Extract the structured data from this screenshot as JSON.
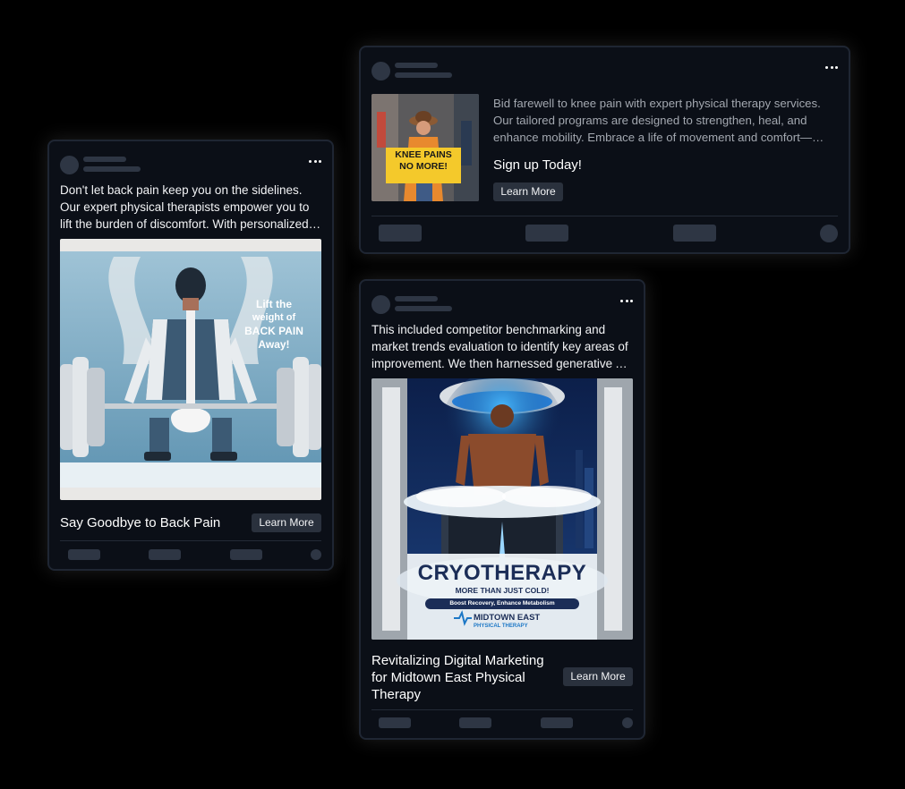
{
  "cards": {
    "back_pain": {
      "body": "Don't let back pain keep you on the sidelines. Our expert physical therapists empower you to lift the burden of discomfort. With personalized treatment plans",
      "image_text": [
        "Lift the",
        "weight of",
        "BACK PAIN",
        "Away!"
      ],
      "headline": "Say Goodbye to Back Pain",
      "cta": "Learn More"
    },
    "knee_pain": {
      "body": "Bid farewell to knee pain with expert physical therapy services. Our tailored programs are designed to strengthen, heal, and enhance mobility. Embrace a life of movement and comfort— book your session now.",
      "sign_text": [
        "KNEE PAINS",
        "NO MORE!"
      ],
      "headline": "Sign up Today!",
      "cta": "Learn More"
    },
    "cryo": {
      "body": "This included competitor benchmarking and market trends evaluation to identify key areas of improvement. We then harnessed generative AI to craft compelling visuals.",
      "poster_title": "CRYOTHERAPY",
      "poster_subtitle": "MORE THAN JUST COLD!",
      "poster_tagline": "Boost Recovery, Enhance Metabolism",
      "poster_brand": "MIDTOWN EAST",
      "poster_brand_sub": "PHYSICAL THERAPY",
      "headline": "Revitalizing Digital Marketing for Midtown East Physical Therapy",
      "cta": "Learn More"
    }
  },
  "icons": {
    "more": "more-dots-icon"
  },
  "colors": {
    "card_bg": "#0b0f17",
    "card_border": "#1f2633",
    "placeholder": "#2e3644",
    "button_bg": "#2a313d",
    "page_bg": "#000000"
  }
}
